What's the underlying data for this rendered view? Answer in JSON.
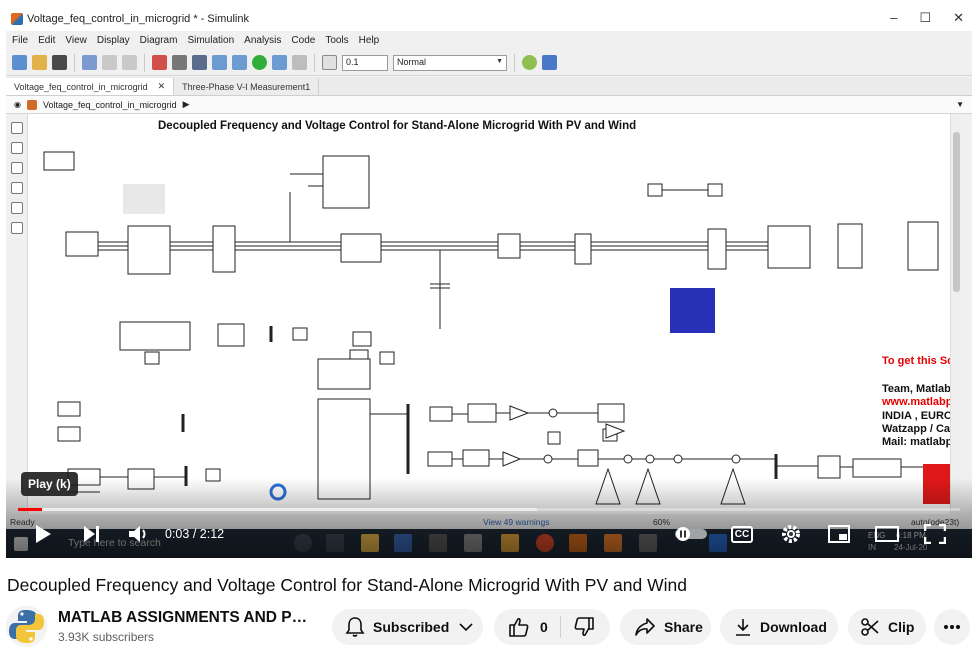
{
  "window": {
    "title": "Voltage_feq_control_in_microgrid * - Simulink",
    "minimize": "–",
    "maximize": "☐",
    "close": "✕"
  },
  "menu": [
    "File",
    "Edit",
    "View",
    "Display",
    "Diagram",
    "Simulation",
    "Analysis",
    "Code",
    "Tools",
    "Help"
  ],
  "toolbar": {
    "stop_time": "0.1",
    "sim_mode": "Normal"
  },
  "tabs": [
    {
      "label": "Voltage_feq_control_in_microgrid",
      "close": "✕"
    },
    {
      "label": "Three-Phase V-I Measurement1"
    }
  ],
  "breadcrumb": {
    "model": "Voltage_feq_control_in_microgrid",
    "arrow": "▶"
  },
  "diagram": {
    "title": "Decoupled Frequency and Voltage Control for Stand-Alone Microgrid With PV and Wind",
    "promo_lines": [
      {
        "text": "To get this Sou",
        "color": "#e60000"
      },
      {
        "text": "Team, Matlab P",
        "color": "#111111"
      },
      {
        "text": "www.matlabpr",
        "color": "#e60000"
      },
      {
        "text": "INDIA , EUROP",
        "color": "#111111"
      },
      {
        "text": "Watzapp / Call",
        "color": "#111111"
      },
      {
        "text": "Mail: matlabpr",
        "color": "#111111"
      }
    ]
  },
  "status": {
    "ready": "Ready",
    "warnings": "View 49 warnings",
    "zoom": "60%",
    "solver": "auto(ode23t)"
  },
  "taskbar": {
    "search_placeholder": "Type here to search",
    "lang": "ENG",
    "region": "IN",
    "time": "6:18 PM",
    "date": "24-Jul-20"
  },
  "player": {
    "tooltip": "Play (k)",
    "current_time": "0:03",
    "duration": "2:12",
    "time_sep": " / ",
    "progress": 0.025,
    "buffered": 0.55,
    "cc_label": "CC"
  },
  "video": {
    "title": "Decoupled Frequency and Voltage Control for Stand-Alone Microgrid With PV and Wind"
  },
  "channel": {
    "name": "MATLAB ASSIGNMENTS AND PROJECTS",
    "subscribers": "3.93K subscribers",
    "subscribed_label": "Subscribed"
  },
  "actions": {
    "likes": "0",
    "share": "Share",
    "download": "Download",
    "clip": "Clip"
  },
  "colors": {
    "accent_red": "#ff0000",
    "pill_bg": "#f2f2f2",
    "taskbar": "#1f2a36",
    "scope_blue": "#2830b8"
  }
}
